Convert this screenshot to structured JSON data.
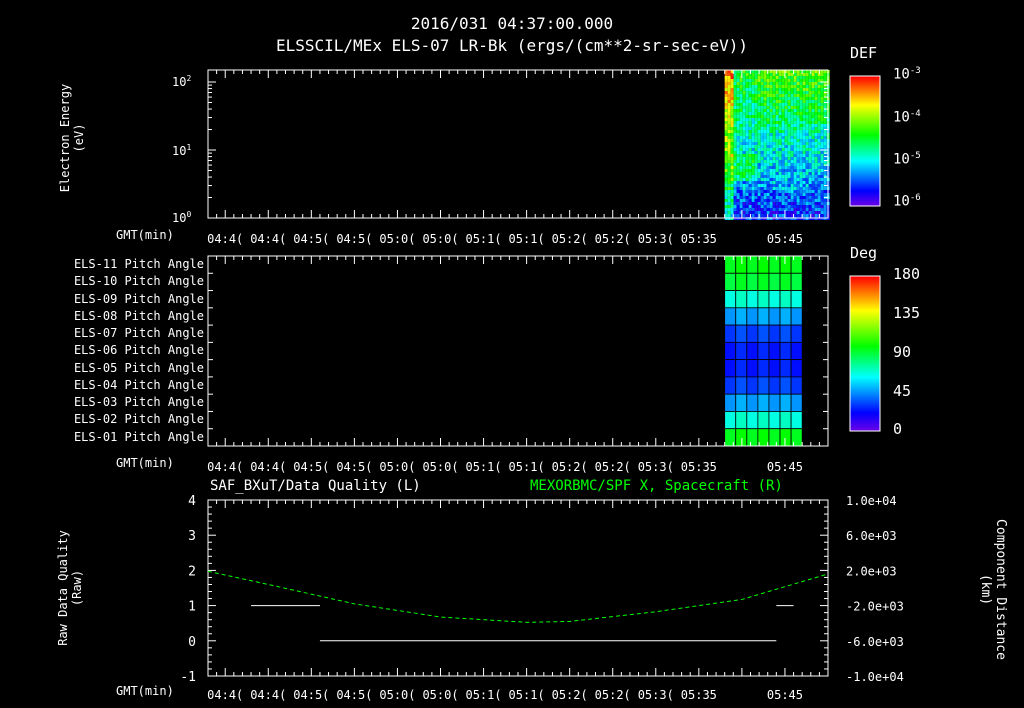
{
  "header": {
    "datetime": "2016/031 04:37:00.000",
    "subtitle": "ELSSCIL/MEx ELS-07 LR-Bk  (ergs/(cm**2-sr-sec-eV))"
  },
  "panel1": {
    "ylabel_line1": "Electron Energy",
    "ylabel_line2": "(eV)",
    "yticks": [
      {
        "base": "10",
        "exp": "2"
      },
      {
        "base": "10",
        "exp": "1"
      },
      {
        "base": "10",
        "exp": "0"
      }
    ],
    "colorbar": {
      "title": "DEF",
      "ticks": [
        {
          "base": "10",
          "exp": "-3"
        },
        {
          "base": "10",
          "exp": "-4"
        },
        {
          "base": "10",
          "exp": "-5"
        },
        {
          "base": "10",
          "exp": "-6"
        }
      ]
    }
  },
  "panel2": {
    "rows": [
      "ELS-11 Pitch Angle",
      "ELS-10 Pitch Angle",
      "ELS-09 Pitch Angle",
      "ELS-08 Pitch Angle",
      "ELS-07 Pitch Angle",
      "ELS-06 Pitch Angle",
      "ELS-05 Pitch Angle",
      "ELS-04 Pitch Angle",
      "ELS-03 Pitch Angle",
      "ELS-02 Pitch Angle",
      "ELS-01 Pitch Angle"
    ],
    "colorbar": {
      "title": "Deg",
      "ticks": [
        "180",
        "135",
        "90",
        "45",
        "0"
      ]
    }
  },
  "panel3": {
    "left_title": "SAF_BXuT/Data Quality (L)",
    "right_title": "MEXORBMC/SPF X, Spacecraft (R)",
    "left_title_color": "#ffffff",
    "right_title_color": "#00ff00",
    "ylabel_left_line1": "Raw Data Quality",
    "ylabel_left_line2": "(Raw)",
    "ylabel_right_line1": "Component Distance",
    "ylabel_right_line2": "(km)",
    "yticks_left": [
      "4",
      "3",
      "2",
      "1",
      "0",
      "-1"
    ],
    "yticks_right": [
      "1.0e+04",
      "6.0e+03",
      "2.0e+03",
      "-2.0e+03",
      "-6.0e+03",
      "-1.0e+04"
    ]
  },
  "time_axis": {
    "label": "GMT(min)",
    "panel1_ticks": [
      "04:4(",
      "04:4(",
      "04:5(",
      "04:5(",
      "05:0(",
      "05:0(",
      "05:1(",
      "05:1(",
      "05:2(",
      "05:2(",
      "05:3(",
      "05:35",
      "05:45"
    ],
    "ticks": [
      "04:4(",
      "04:4(",
      "04:5(",
      "04:5(",
      "05:0(",
      "05:0(",
      "05:1(",
      "05:1(",
      "05:2(",
      "05:2(",
      "05:3(",
      "05:35",
      "05:45"
    ]
  },
  "chart_data": [
    {
      "type": "heatmap",
      "title": "ELSSCIL/MEx ELS-07 LR-Bk  (ergs/(cm**2-sr-sec-eV))",
      "ylabel": "Electron Energy (eV)",
      "yscale": "log",
      "ylim": [
        1,
        150
      ],
      "xlabel": "GMT(min)",
      "colorbar": {
        "label": "DEF",
        "scale": "log",
        "range": [
          1e-06,
          0.001
        ]
      },
      "note_data_present_from": "05:38"
    },
    {
      "type": "heatmap",
      "xlabel": "GMT(min)",
      "rows": [
        "ELS-11 Pitch Angle",
        "ELS-10 Pitch Angle",
        "ELS-09 Pitch Angle",
        "ELS-08 Pitch Angle",
        "ELS-07 Pitch Angle",
        "ELS-06 Pitch Angle",
        "ELS-05 Pitch Angle",
        "ELS-04 Pitch Angle",
        "ELS-03 Pitch Angle",
        "ELS-02 Pitch Angle",
        "ELS-01 Pitch Angle"
      ],
      "row_values_deg": [
        95,
        90,
        65,
        42,
        25,
        18,
        18,
        25,
        42,
        65,
        95
      ],
      "colorbar": {
        "label": "Deg",
        "range": [
          0,
          180
        ]
      }
    },
    {
      "type": "line",
      "xlabel": "GMT(min)",
      "ylim_left": [
        -1,
        4
      ],
      "ylim_right": [
        -10000,
        10000
      ],
      "series": [
        {
          "name": "SAF_BXuT/Data Quality (L)",
          "axis": "left",
          "color": "#ffffff",
          "segments": [
            {
              "x": [
                "04:43",
                "04:51"
              ],
              "y": [
                1,
                1
              ]
            },
            {
              "x": [
                "04:51",
                "05:44"
              ],
              "y": [
                0,
                0
              ]
            },
            {
              "x": [
                "05:44",
                "05:46"
              ],
              "y": [
                1,
                1
              ]
            }
          ]
        },
        {
          "name": "MEXORBMC/SPF X, Spacecraft (R)",
          "axis": "right",
          "color": "#00ff00",
          "x": [
            "04:38",
            "04:45",
            "04:55",
            "05:05",
            "05:15",
            "05:20",
            "05:30",
            "05:40",
            "05:50"
          ],
          "y": [
            1900,
            400,
            -1800,
            -3300,
            -3900,
            -3800,
            -2700,
            -1300,
            1600
          ]
        }
      ]
    }
  ]
}
